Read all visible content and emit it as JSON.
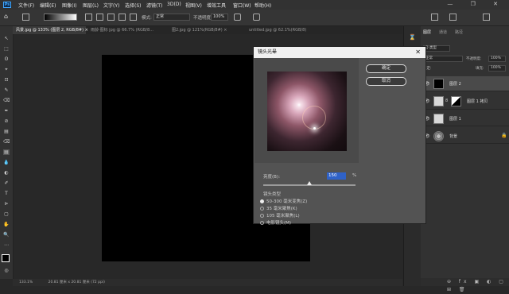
{
  "app": {
    "logo": "Ps"
  },
  "menu": [
    "文件(F)",
    "编辑(E)",
    "图像(I)",
    "图层(L)",
    "文字(Y)",
    "选择(S)",
    "滤镜(T)",
    "3D(D)",
    "视图(V)",
    "增效工具",
    "窗口(W)",
    "帮助(H)"
  ],
  "window_controls": "— ❐ ✕",
  "options_bar": {
    "mode_label": "模式:",
    "mode_value": "正常",
    "opacity_label": "不透明度:",
    "opacity_value": "100%"
  },
  "tabs": [
    {
      "label": "风景.jpg @ 133% (图层 2, RGB/8#) ×",
      "active": true
    },
    {
      "label": "雨龄·图标 jpg @ 66.7% (RGB/8...",
      "active": false
    },
    {
      "label": "图2.jpg @ 121%(RGB/8#) ×",
      "active": false
    },
    {
      "label": "untitled.jpg @ 62.1%(RGB/8)",
      "active": false
    }
  ],
  "tools": [
    "↖",
    "⬚",
    "ʘ",
    "⌖",
    "⊡",
    "✎",
    "⌫",
    "✒",
    "⊘",
    "▤",
    "◐",
    "✐",
    "T",
    "⊳",
    "✋",
    "🔍"
  ],
  "status": {
    "zoom": "133.1%",
    "doc": "20.81 厘米 x 20.81 厘米 (72 ppi)"
  },
  "panels": {
    "tabs": [
      "图层",
      "通道",
      "路径"
    ],
    "filter_label": "Q 类型",
    "blend_mode": "正常",
    "opacity_label": "不透明度:",
    "opacity_value": "100%",
    "lock_label": "锁定:",
    "fill_label": "填充:",
    "fill_value": "100%"
  },
  "layers": [
    {
      "name": "图层 2",
      "selected": true
    },
    {
      "name": "图层 1 拷贝",
      "selected": false
    },
    {
      "name": "图层 1",
      "selected": false
    },
    {
      "name": "背景",
      "selected": false
    }
  ],
  "layer_buttons": "⊖ fx ▣ ◐ ▢ ⊞ 🗑",
  "dialog": {
    "title": "镜头光晕",
    "close": "✕",
    "ok_label": "确定",
    "cancel_label": "取消",
    "brightness_label": "亮度(B):",
    "brightness_value": "150",
    "brightness_unit": "%",
    "brightness_level_pct": 50,
    "lens_type_label": "镜头类型",
    "lens_options": [
      {
        "label": "50-300 毫米变焦(Z)",
        "checked": true
      },
      {
        "label": "35 毫米聚焦(K)",
        "checked": false
      },
      {
        "label": "105 毫米聚焦(L)",
        "checked": false
      },
      {
        "label": "电影镜头(M)",
        "checked": false
      }
    ]
  },
  "colors": {
    "accent": "#2f62c8",
    "canvas": "#000000",
    "panel": "#323232"
  }
}
